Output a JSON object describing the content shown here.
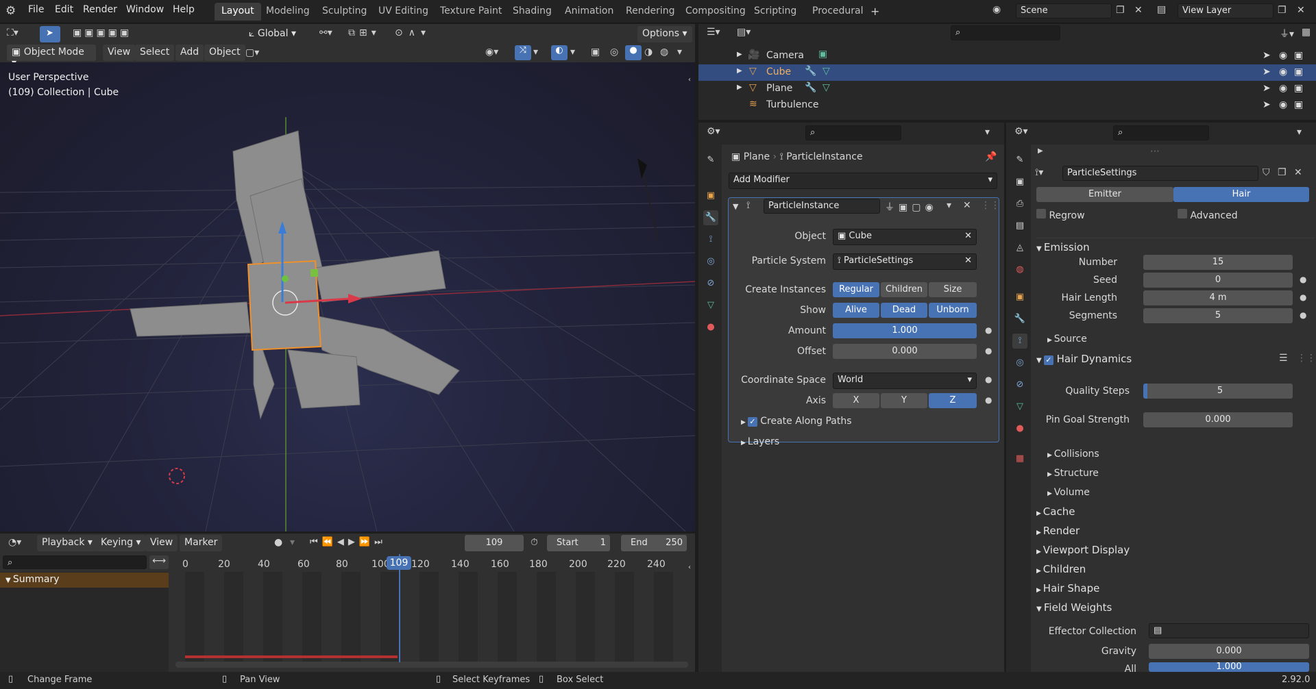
{
  "menu": [
    "File",
    "Edit",
    "Render",
    "Window",
    "Help"
  ],
  "workspaces": [
    "Layout",
    "Modeling",
    "Sculpting",
    "UV Editing",
    "Texture Paint",
    "Shading",
    "Animation",
    "Rendering",
    "Compositing",
    "Scripting",
    "Procedural"
  ],
  "scene_label": "Scene",
  "view_layer_label": "View Layer",
  "viewport": {
    "transform_orientation": "Global",
    "options_label": "Options",
    "mode_label": "Object Mode",
    "header_menus": [
      "View",
      "Select",
      "Add",
      "Object"
    ],
    "overlay_title": "User Perspective",
    "overlay_subtitle": "(109) Collection | Cube"
  },
  "outliner": {
    "rows": [
      {
        "name": "Camera",
        "selected": false
      },
      {
        "name": "Cube",
        "selected": true
      },
      {
        "name": "Plane",
        "selected": false
      },
      {
        "name": "Turbulence",
        "selected": false
      }
    ]
  },
  "modifier_panel": {
    "breadcrumb_object": "Plane",
    "breadcrumb_modifier": "ParticleInstance",
    "add_modifier": "Add Modifier",
    "modifier_name": "ParticleInstance",
    "object_label": "Object",
    "object_value": "Cube",
    "particle_system_label": "Particle System",
    "particle_system_value": "ParticleSettings",
    "create_instances_label": "Create Instances",
    "create_instances": [
      "Regular",
      "Children",
      "Size"
    ],
    "show_label": "Show",
    "show": [
      "Alive",
      "Dead",
      "Unborn"
    ],
    "amount_label": "Amount",
    "amount_value": "1.000",
    "offset_label": "Offset",
    "offset_value": "0.000",
    "coord_space_label": "Coordinate Space",
    "coord_space_value": "World",
    "axis_label": "Axis",
    "axis": [
      "X",
      "Y",
      "Z"
    ],
    "create_along_paths": "Create Along Paths",
    "layers": "Layers"
  },
  "particle_panel": {
    "settings_name": "ParticleSettings",
    "tabs": [
      "Emitter",
      "Hair"
    ],
    "regrow": "Regrow",
    "advanced": "Advanced",
    "emission": "Emission",
    "number_label": "Number",
    "number_value": "15",
    "seed_label": "Seed",
    "seed_value": "0",
    "hair_length_label": "Hair Length",
    "hair_length_value": "4 m",
    "segments_label": "Segments",
    "segments_value": "5",
    "source": "Source",
    "hair_dynamics": "Hair Dynamics",
    "quality_steps_label": "Quality Steps",
    "quality_steps_value": "5",
    "pin_goal_label": "Pin Goal Strength",
    "pin_goal_value": "0.000",
    "sub_sections": [
      "Collisions",
      "Structure",
      "Volume"
    ],
    "sections": [
      "Cache",
      "Render",
      "Viewport Display",
      "Children",
      "Hair Shape"
    ],
    "field_weights": "Field Weights",
    "effector_collection_label": "Effector Collection",
    "gravity_label": "Gravity",
    "gravity_value": "0.000",
    "all_label": "All",
    "all_value": "1.000"
  },
  "timeline": {
    "menus": [
      "Playback",
      "Keying",
      "View",
      "Marker"
    ],
    "current_frame": "109",
    "start_label": "Start",
    "start_value": "1",
    "end_label": "End",
    "end_value": "250",
    "ticks": [
      "0",
      "20",
      "40",
      "60",
      "80",
      "100",
      "120",
      "140",
      "160",
      "180",
      "200",
      "220",
      "240"
    ],
    "summary": "Summary"
  },
  "status": {
    "items": [
      "Change Frame",
      "Pan View",
      "Select Keyframes",
      "Box Select"
    ],
    "version": "2.92.0"
  }
}
